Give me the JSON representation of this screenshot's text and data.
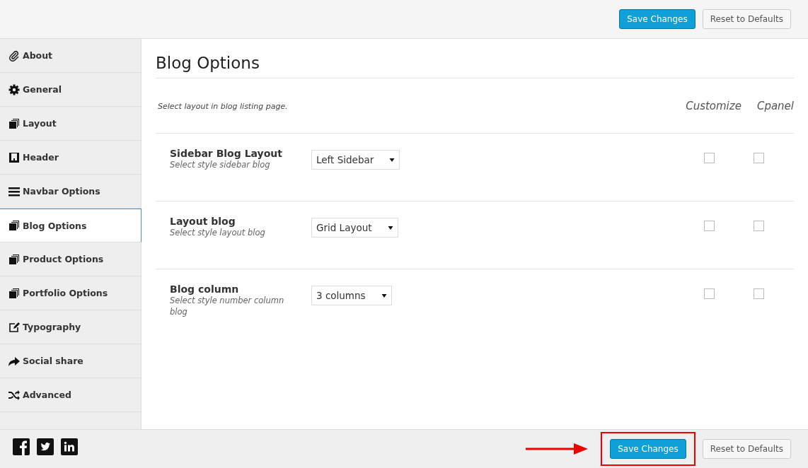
{
  "top_bar": {
    "save_button": "Save Changes",
    "reset_button": "Reset to Defaults"
  },
  "sidebar": {
    "items": [
      {
        "label": "About",
        "kind": "paperclip",
        "selected": false
      },
      {
        "label": "General",
        "kind": "gear",
        "selected": false
      },
      {
        "label": "Layout",
        "kind": "copies",
        "selected": false
      },
      {
        "label": "Header",
        "kind": "header",
        "selected": false
      },
      {
        "label": "Navbar Options",
        "kind": "bars",
        "selected": false
      },
      {
        "label": "Blog Options",
        "kind": "copies",
        "selected": true
      },
      {
        "label": "Product Options",
        "kind": "copies",
        "selected": false
      },
      {
        "label": "Portfolio Options",
        "kind": "copies",
        "selected": false
      },
      {
        "label": "Typography",
        "kind": "edit",
        "selected": false
      },
      {
        "label": "Social share",
        "kind": "share",
        "selected": false
      },
      {
        "label": "Advanced",
        "kind": "random",
        "selected": false
      }
    ]
  },
  "content": {
    "title": "Blog Options",
    "description": "Select layout in blog listing page.",
    "column_headers": [
      "Customize",
      "Cpanel"
    ],
    "rows": [
      {
        "label": "Sidebar Blog Layout",
        "hint": "Select style sidebar blog",
        "value": "Left Sidebar",
        "customize_checked": false,
        "cpanel_checked": false
      },
      {
        "label": "Layout blog",
        "hint": "Select style layout blog",
        "value": "Grid Layout",
        "customize_checked": false,
        "cpanel_checked": false
      },
      {
        "label": "Blog column",
        "hint": "Select style number column blog",
        "value": "3 columns",
        "customize_checked": false,
        "cpanel_checked": false
      }
    ]
  },
  "footer": {
    "save_button": "Save Changes",
    "reset_button": "Reset to Defaults",
    "highlight_save": true
  }
}
